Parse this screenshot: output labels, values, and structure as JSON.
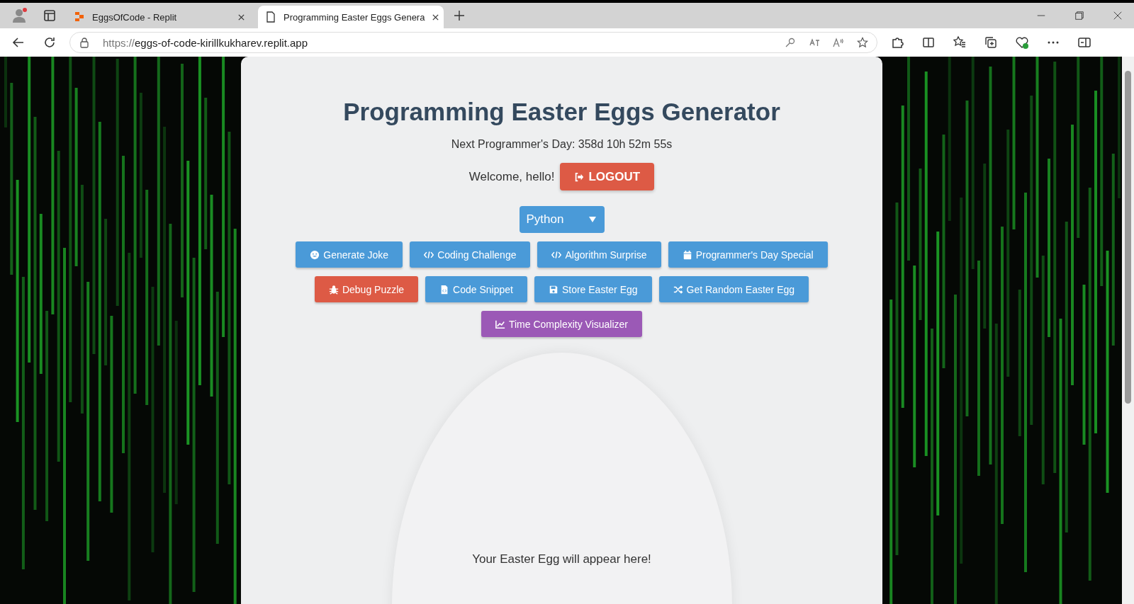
{
  "browser": {
    "tabs": [
      {
        "title": "EggsOfCode - Replit",
        "selected": false,
        "kind": "replit"
      },
      {
        "title": "Programming Easter Eggs Genera",
        "selected": true,
        "kind": "page"
      }
    ],
    "address": {
      "scheme": "https://",
      "host": "eggs-of-code-kirillkukharev.replit.app"
    }
  },
  "page": {
    "title": "Programming Easter Eggs Generator",
    "countdown": "Next Programmer's Day: 358d 10h 52m 55s",
    "welcome": "Welcome, hello!",
    "logout": "LOGOUT",
    "language": "Python",
    "button_rows": [
      [
        {
          "label": "Generate Joke",
          "kind": "smile",
          "color": "#4a9ad8"
        },
        {
          "label": "Coding Challenge",
          "kind": "code",
          "color": "#4a9ad8"
        },
        {
          "label": "Algorithm Surprise",
          "kind": "code",
          "color": "#4a9ad8"
        },
        {
          "label": "Programmer's Day Special",
          "kind": "calendar",
          "color": "#4a9ad8"
        }
      ],
      [
        {
          "label": "Debug Puzzle",
          "kind": "bug",
          "color": "#dd5a45"
        },
        {
          "label": "Code Snippet",
          "kind": "file",
          "color": "#4a9ad8"
        },
        {
          "label": "Store Easter Egg",
          "kind": "save",
          "color": "#4a9ad8"
        },
        {
          "label": "Get Random Easter Egg",
          "kind": "shuffle",
          "color": "#4a9ad8"
        }
      ],
      [
        {
          "label": "Time Complexity Visualizer",
          "kind": "chart",
          "color": "#9b59b6"
        }
      ]
    ],
    "egg_text": "Your Easter Egg will appear here!"
  }
}
